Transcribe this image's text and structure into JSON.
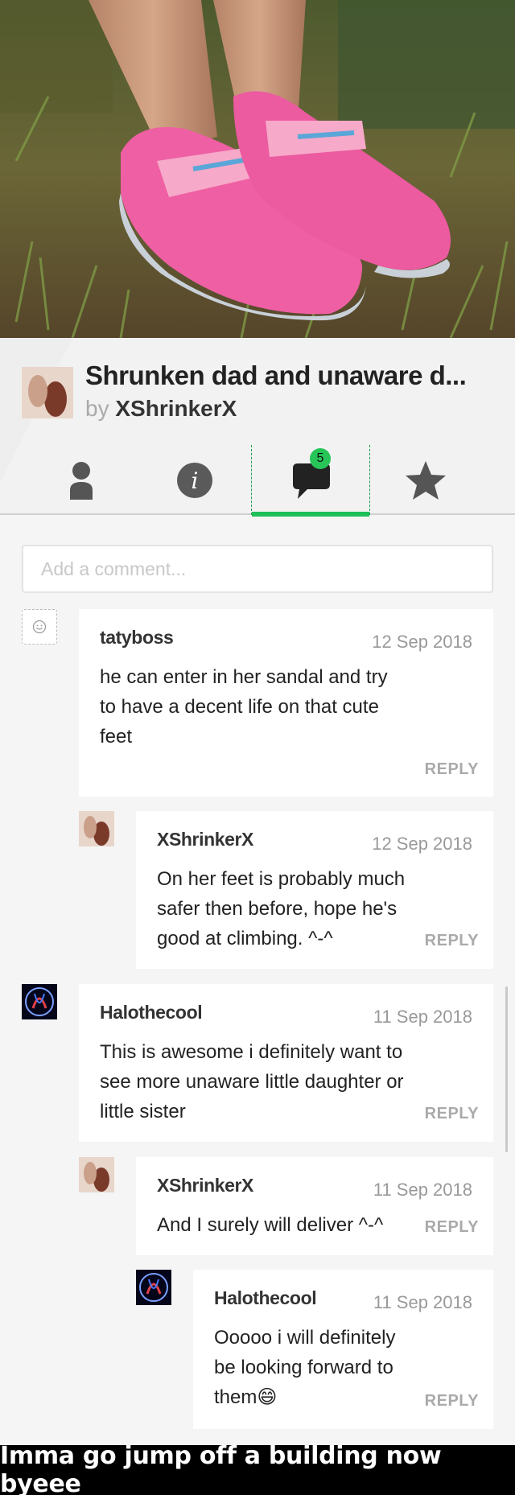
{
  "story": {
    "title": "Shrunken dad and unaware d...",
    "by_label": "by",
    "author": "XShrinkerX"
  },
  "tabs": [
    {
      "icon": "person-icon",
      "active": false
    },
    {
      "icon": "info-icon",
      "active": false
    },
    {
      "icon": "comments-icon",
      "active": true,
      "badge": "5"
    },
    {
      "icon": "star-icon",
      "active": false
    }
  ],
  "comment_input": {
    "placeholder": "Add a comment..."
  },
  "comments": [
    {
      "user": "tatyboss",
      "date": "12 Sep 2018",
      "text": [
        "he can enter in her sandal and try",
        "to have a decent life on that cute",
        "feet"
      ],
      "reply": "REPLY"
    },
    {
      "user": "XShrinkerX",
      "date": "12 Sep 2018",
      "text": [
        "On her feet is probably much",
        "safer then before, hope he's",
        "good at climbing. ^-^"
      ],
      "reply": "REPLY"
    },
    {
      "user": "Halothecool",
      "date": "11 Sep 2018",
      "text": [
        "This is awesome i definitely want to",
        "see more unaware little daughter or",
        "little sister"
      ],
      "reply": "REPLY"
    },
    {
      "user": "XShrinkerX",
      "date": "11 Sep 2018",
      "text": [
        "And I surely will deliver ^-^"
      ],
      "reply": "REPLY"
    },
    {
      "user": "Halothecool",
      "date": "11 Sep 2018",
      "text": [
        "Ooooo i will definitely",
        "be looking forward to",
        "them😄"
      ],
      "reply": "REPLY"
    }
  ],
  "caption": "Imma go jump off a building now byeee",
  "colors": {
    "accent": "#1fbf5a",
    "badge": "#27c458"
  }
}
